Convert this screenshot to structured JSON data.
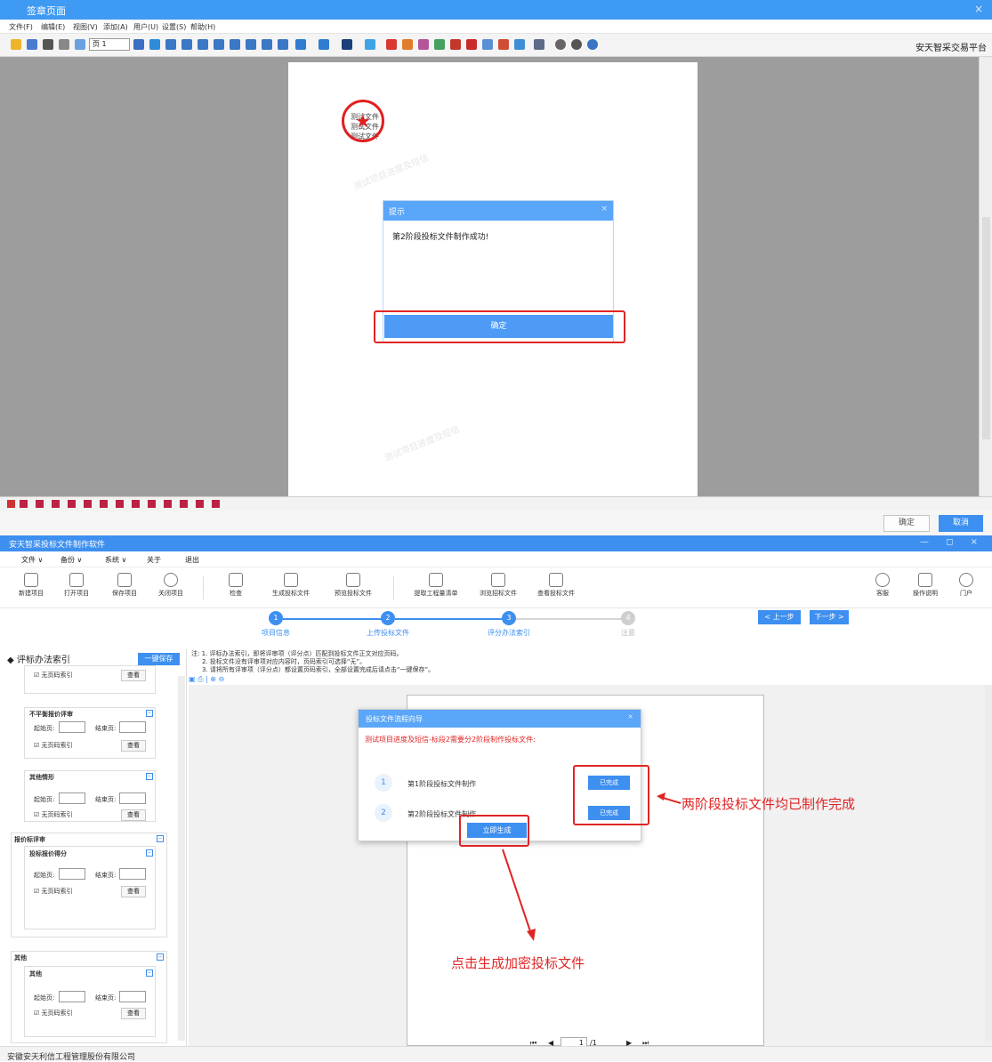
{
  "signing_window": {
    "title": "签章页面",
    "close": "×",
    "menu": [
      "文件(F)",
      "编辑(E)",
      "视图(V)",
      "添加(A)",
      "用户(U)",
      "设置(S)",
      "帮助(H)"
    ],
    "page_field": "页 1",
    "brand": "安天智采交易平台",
    "doc_lines": [
      "测试文件",
      "测试文件",
      "测试文件"
    ],
    "watermark": "测试项目进度及短信",
    "alert": {
      "title": "提示",
      "message": "第2阶段投标文件制作成功!",
      "ok_label": "确定"
    },
    "confirm_label": "确定",
    "cancel_label": "取消"
  },
  "app": {
    "title": "安天智采投标文件制作软件",
    "window_controls": "— ◻ ×",
    "menu": [
      "文件 ∨",
      "备份 ∨",
      "系统 ∨",
      "关于",
      "退出"
    ],
    "tools": [
      "新建项目",
      "打开项目",
      "保存项目",
      "关闭项目",
      "检查",
      "生成投标文件",
      "预览投标文件",
      "提取工程量清单",
      "浏览招标文件",
      "查看投标文件",
      "客服",
      "操作说明",
      "门户"
    ],
    "steps": [
      {
        "num": "1",
        "label": "项目信息"
      },
      {
        "num": "2",
        "label": "上传投标文件"
      },
      {
        "num": "3",
        "label": "评分办法索引"
      },
      {
        "num": "4",
        "label": "注意"
      }
    ],
    "prev_label": "< 上一步",
    "next_label": "下一步 >",
    "sidebar": {
      "title": "评标办法索引",
      "save_all": "一键保存",
      "start_label": "起始页:",
      "end_label": "结束页:",
      "no_index_label": "☑ 无页码索引",
      "view_label": "查看",
      "groups": [
        {
          "title": "不平衡报价评审"
        },
        {
          "title": "其他情形"
        },
        {
          "title": "报价标评审"
        },
        {
          "title": "投标报价得分"
        },
        {
          "title": "其他"
        },
        {
          "title": "其他"
        }
      ]
    },
    "notes": [
      "注: 1. 评标办法索引，即将评审项（评分点）匹配到投标文件正文对应页码。",
      "2. 投标文件没有评审项对应内容时，页码索引可选择“无”。",
      "3. 请将所有评审项（评分点）都设置页码索引，全部设置完成后请点击“一键保存”。"
    ],
    "wizard": {
      "title": "投标文件流程向导",
      "subtitle": "测试项目进度及短信-标段2需要分2阶段制作投标文件:",
      "rows": [
        {
          "num": "1",
          "label": "第1阶段投标文件制作",
          "status": "已完成"
        },
        {
          "num": "2",
          "label": "第2阶段投标文件制作",
          "status": "已完成"
        }
      ],
      "generate_label": "立即生成"
    },
    "annotation_right": "两阶段投标文件均已制作完成",
    "annotation_bottom": "点击生成加密投标文件",
    "pager": {
      "first": "⏮",
      "prev": "◀",
      "page": "1",
      "total": "/1",
      "next": "▶",
      "last": "⏭"
    },
    "footer": "安徽安天利信工程管理股份有限公司"
  },
  "colors": {
    "accent": "#3d8ff0",
    "highlight": "#e02424",
    "title_bar": "#3f9af3"
  }
}
